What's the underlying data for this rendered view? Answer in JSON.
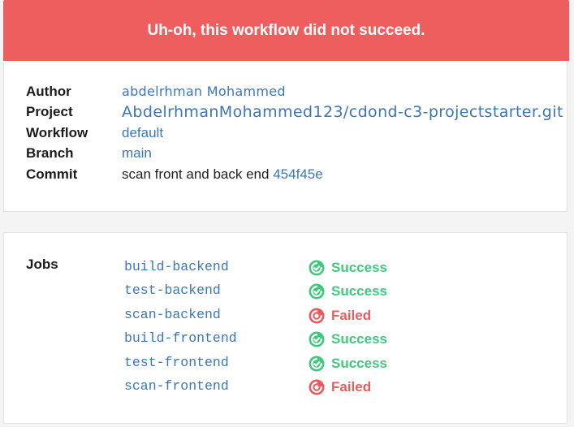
{
  "banner": {
    "message": "Uh-oh, this workflow did not succeed.",
    "color": "#ee5e5e"
  },
  "details": {
    "author": {
      "label": "Author",
      "value": "abdelrhman Mohammed"
    },
    "project": {
      "label": "Project",
      "value": "AbdelrhmanMohammed123/cdond-c3-projectstarter.git"
    },
    "workflow": {
      "label": "Workflow",
      "value": "default"
    },
    "branch": {
      "label": "Branch",
      "value": "main"
    },
    "commit": {
      "label": "Commit",
      "message": "scan front and back end",
      "hash": "454f45e"
    }
  },
  "jobs": {
    "label": "Jobs",
    "items": [
      {
        "name": "build-backend",
        "status": "Success",
        "state": "success"
      },
      {
        "name": "test-backend",
        "status": "Success",
        "state": "success"
      },
      {
        "name": "scan-backend",
        "status": "Failed",
        "state": "failed"
      },
      {
        "name": "build-frontend",
        "status": "Success",
        "state": "success"
      },
      {
        "name": "test-frontend",
        "status": "Success",
        "state": "success"
      },
      {
        "name": "scan-frontend",
        "status": "Failed",
        "state": "failed"
      }
    ]
  },
  "colors": {
    "success": "#42c77f",
    "failed": "#ec5b5b",
    "link": "#3b76b5"
  },
  "icons": {
    "success": "status-success-icon",
    "failed": "status-failed-icon"
  }
}
